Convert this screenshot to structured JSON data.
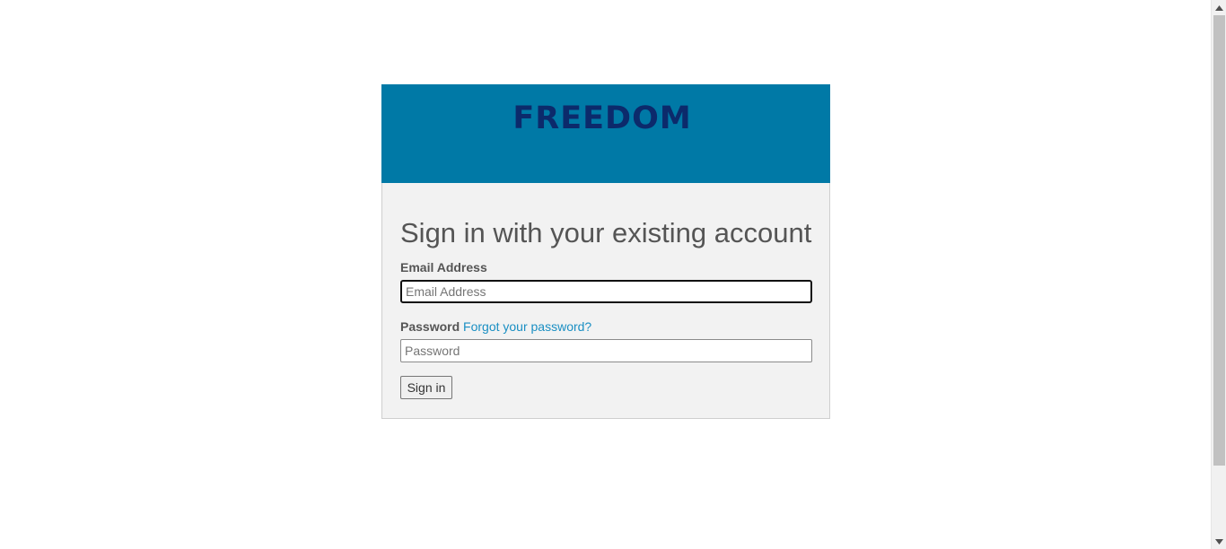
{
  "brand": {
    "logo_text": "FREEDOM",
    "banner_color": "#0079a6",
    "logo_color": "#0c2a6b"
  },
  "form": {
    "heading": "Sign in with your existing account",
    "email_label": "Email Address",
    "email_placeholder": "Email Address",
    "email_value": "",
    "password_label": "Password",
    "forgot_link": "Forgot your password?",
    "password_placeholder": "Password",
    "password_value": "",
    "submit_label": "Sign in"
  },
  "colors": {
    "panel_bg": "#f2f2f2",
    "link": "#1a8fc3",
    "text": "#555555"
  },
  "icons": {
    "scroll_up": "triangle-up-icon",
    "scroll_down": "triangle-down-icon"
  }
}
